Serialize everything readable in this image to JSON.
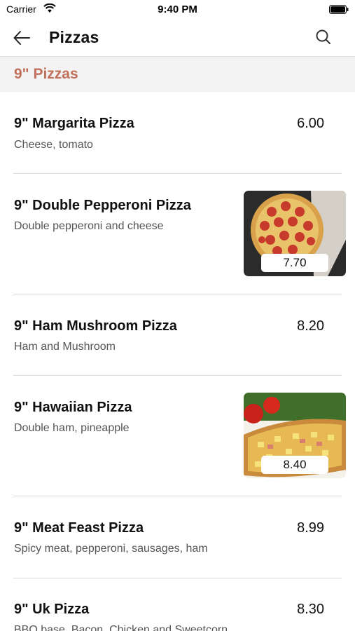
{
  "status_bar": {
    "carrier": "Carrier",
    "time": "9:40 PM"
  },
  "nav": {
    "title": "Pizzas",
    "back_icon": "arrow-left-icon",
    "search_icon": "search-icon"
  },
  "section": {
    "title": "9\" Pizzas"
  },
  "items": [
    {
      "name": "9\" Margarita Pizza",
      "description": "Cheese, tomato",
      "price": "6.00"
    },
    {
      "name": "9\" Double Pepperoni Pizza",
      "description": "Double pepperoni and cheese",
      "price": "7.70"
    },
    {
      "name": "9\" Ham Mushroom Pizza",
      "description": "Ham and Mushroom",
      "price": "8.20"
    },
    {
      "name": "9\" Hawaiian Pizza",
      "description": "Double ham, pineapple",
      "price": "8.40"
    },
    {
      "name": "9\" Meat Feast Pizza",
      "description": "Spicy meat, pepperoni, sausages, ham",
      "price": "8.99"
    },
    {
      "name": "9\" Uk Pizza",
      "description": "BBQ base, Bacon, Chicken and Sweetcorn",
      "price": "8.30"
    }
  ],
  "colors": {
    "section_title": "#c0705a",
    "section_bg": "#f3f3f3",
    "divider": "#dcdcdc"
  }
}
